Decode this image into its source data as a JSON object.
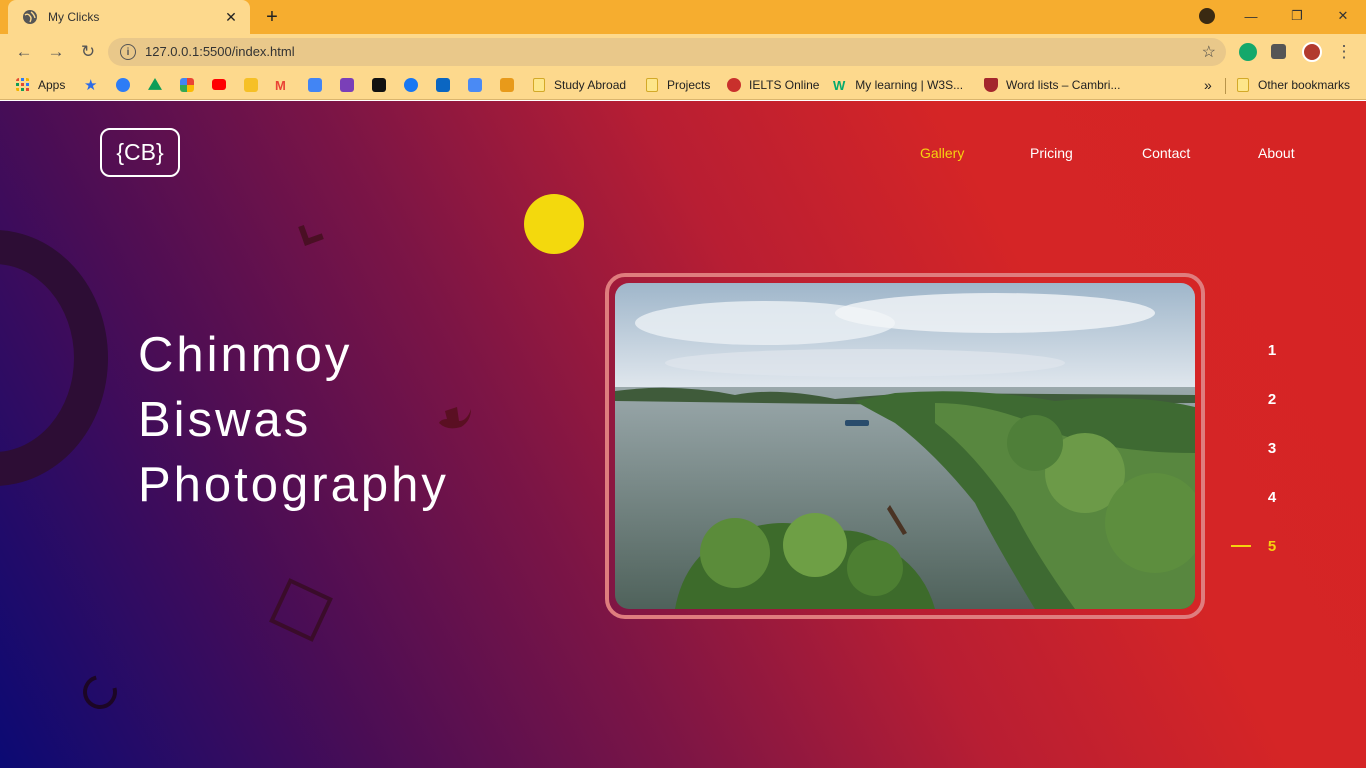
{
  "browser": {
    "tab_title": "My Clicks",
    "url": "127.0.0.1:5500/index.html",
    "bookmarks": [
      "Apps",
      "Study Abroad",
      "Projects",
      "IELTS Online",
      "My learning | W3S...",
      "Word lists – Cambri...",
      "Other bookmarks"
    ],
    "more_bookmarks": "»",
    "accent": "#f6ad2f"
  },
  "site": {
    "logo": "{CB}",
    "nav": [
      "Gallery",
      "Pricing",
      "Contact",
      "About"
    ],
    "active_nav": "Gallery",
    "hero_lines": [
      "Chinmoy",
      "Biswas",
      "Photography"
    ],
    "slides": [
      "1",
      "2",
      "3",
      "4",
      "5"
    ],
    "active_slide": "5",
    "colors": {
      "highlight": "#f6d20f",
      "gradient_start": "#0b0a74",
      "gradient_end": "#d62424"
    }
  }
}
